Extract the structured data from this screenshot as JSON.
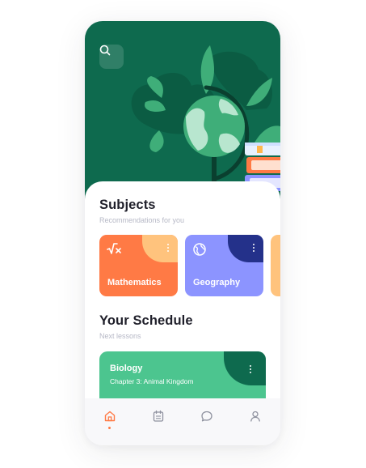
{
  "colors": {
    "hero_bg": "#0e6a4e",
    "accent_orange": "#ff7a45",
    "math_card": "#ff7a45",
    "math_card_blob": "#ffc37d",
    "geography_card": "#8c94ff",
    "geography_card_blob": "#24318a",
    "schedule_card": "#4cc58f",
    "schedule_card_blob": "#0e6a4e",
    "title_text": "#1f1f2a",
    "subtitle_text": "#b6b8c6"
  },
  "header": {
    "search_icon": "search-icon",
    "illustration": "globe-with-books-illustration"
  },
  "subjects": {
    "title": "Subjects",
    "subtitle": "Recommendations for you",
    "cards": [
      {
        "label": "Mathematics",
        "icon": "square-root-icon",
        "menu_icon": "more-vertical-icon"
      },
      {
        "label": "Geography",
        "icon": "globe-icon",
        "menu_icon": "more-vertical-icon"
      }
    ]
  },
  "schedule": {
    "title": "Your Schedule",
    "subtitle": "Next lessons",
    "lessons": [
      {
        "subject": "Biology",
        "chapter": "Chapter 3: Animal Kingdom",
        "menu_icon": "more-vertical-icon"
      }
    ]
  },
  "bottom_nav": {
    "items": [
      {
        "icon": "home-icon",
        "active": true
      },
      {
        "icon": "calendar-icon",
        "active": false
      },
      {
        "icon": "chat-icon",
        "active": false
      },
      {
        "icon": "profile-icon",
        "active": false
      }
    ]
  }
}
